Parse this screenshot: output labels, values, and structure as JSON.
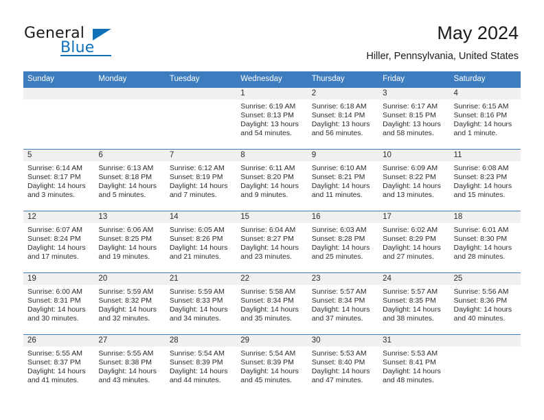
{
  "brand": {
    "word_one": "General",
    "word_two": "Blue",
    "accent_color": "#1071ba",
    "triangle_icon": "triangle-icon"
  },
  "header": {
    "month_title": "May 2024",
    "location": "Hiller, Pennsylvania, United States"
  },
  "calendar": {
    "header_bg": "#3d7cbf",
    "daynum_bg": "#f0f0f0",
    "weekday_headers": [
      "Sunday",
      "Monday",
      "Tuesday",
      "Wednesday",
      "Thursday",
      "Friday",
      "Saturday"
    ],
    "labels": {
      "sunrise": "Sunrise:",
      "sunset": "Sunset:",
      "daylight": "Daylight:"
    },
    "weeks": [
      [
        {
          "day": "",
          "sunrise": "",
          "sunset": "",
          "daylight_line1": "",
          "daylight_line2": ""
        },
        {
          "day": "",
          "sunrise": "",
          "sunset": "",
          "daylight_line1": "",
          "daylight_line2": ""
        },
        {
          "day": "",
          "sunrise": "",
          "sunset": "",
          "daylight_line1": "",
          "daylight_line2": ""
        },
        {
          "day": "1",
          "sunrise": "Sunrise: 6:19 AM",
          "sunset": "Sunset: 8:13 PM",
          "daylight_line1": "Daylight: 13 hours",
          "daylight_line2": "and 54 minutes."
        },
        {
          "day": "2",
          "sunrise": "Sunrise: 6:18 AM",
          "sunset": "Sunset: 8:14 PM",
          "daylight_line1": "Daylight: 13 hours",
          "daylight_line2": "and 56 minutes."
        },
        {
          "day": "3",
          "sunrise": "Sunrise: 6:17 AM",
          "sunset": "Sunset: 8:15 PM",
          "daylight_line1": "Daylight: 13 hours",
          "daylight_line2": "and 58 minutes."
        },
        {
          "day": "4",
          "sunrise": "Sunrise: 6:15 AM",
          "sunset": "Sunset: 8:16 PM",
          "daylight_line1": "Daylight: 14 hours",
          "daylight_line2": "and 1 minute."
        }
      ],
      [
        {
          "day": "5",
          "sunrise": "Sunrise: 6:14 AM",
          "sunset": "Sunset: 8:17 PM",
          "daylight_line1": "Daylight: 14 hours",
          "daylight_line2": "and 3 minutes."
        },
        {
          "day": "6",
          "sunrise": "Sunrise: 6:13 AM",
          "sunset": "Sunset: 8:18 PM",
          "daylight_line1": "Daylight: 14 hours",
          "daylight_line2": "and 5 minutes."
        },
        {
          "day": "7",
          "sunrise": "Sunrise: 6:12 AM",
          "sunset": "Sunset: 8:19 PM",
          "daylight_line1": "Daylight: 14 hours",
          "daylight_line2": "and 7 minutes."
        },
        {
          "day": "8",
          "sunrise": "Sunrise: 6:11 AM",
          "sunset": "Sunset: 8:20 PM",
          "daylight_line1": "Daylight: 14 hours",
          "daylight_line2": "and 9 minutes."
        },
        {
          "day": "9",
          "sunrise": "Sunrise: 6:10 AM",
          "sunset": "Sunset: 8:21 PM",
          "daylight_line1": "Daylight: 14 hours",
          "daylight_line2": "and 11 minutes."
        },
        {
          "day": "10",
          "sunrise": "Sunrise: 6:09 AM",
          "sunset": "Sunset: 8:22 PM",
          "daylight_line1": "Daylight: 14 hours",
          "daylight_line2": "and 13 minutes."
        },
        {
          "day": "11",
          "sunrise": "Sunrise: 6:08 AM",
          "sunset": "Sunset: 8:23 PM",
          "daylight_line1": "Daylight: 14 hours",
          "daylight_line2": "and 15 minutes."
        }
      ],
      [
        {
          "day": "12",
          "sunrise": "Sunrise: 6:07 AM",
          "sunset": "Sunset: 8:24 PM",
          "daylight_line1": "Daylight: 14 hours",
          "daylight_line2": "and 17 minutes."
        },
        {
          "day": "13",
          "sunrise": "Sunrise: 6:06 AM",
          "sunset": "Sunset: 8:25 PM",
          "daylight_line1": "Daylight: 14 hours",
          "daylight_line2": "and 19 minutes."
        },
        {
          "day": "14",
          "sunrise": "Sunrise: 6:05 AM",
          "sunset": "Sunset: 8:26 PM",
          "daylight_line1": "Daylight: 14 hours",
          "daylight_line2": "and 21 minutes."
        },
        {
          "day": "15",
          "sunrise": "Sunrise: 6:04 AM",
          "sunset": "Sunset: 8:27 PM",
          "daylight_line1": "Daylight: 14 hours",
          "daylight_line2": "and 23 minutes."
        },
        {
          "day": "16",
          "sunrise": "Sunrise: 6:03 AM",
          "sunset": "Sunset: 8:28 PM",
          "daylight_line1": "Daylight: 14 hours",
          "daylight_line2": "and 25 minutes."
        },
        {
          "day": "17",
          "sunrise": "Sunrise: 6:02 AM",
          "sunset": "Sunset: 8:29 PM",
          "daylight_line1": "Daylight: 14 hours",
          "daylight_line2": "and 27 minutes."
        },
        {
          "day": "18",
          "sunrise": "Sunrise: 6:01 AM",
          "sunset": "Sunset: 8:30 PM",
          "daylight_line1": "Daylight: 14 hours",
          "daylight_line2": "and 28 minutes."
        }
      ],
      [
        {
          "day": "19",
          "sunrise": "Sunrise: 6:00 AM",
          "sunset": "Sunset: 8:31 PM",
          "daylight_line1": "Daylight: 14 hours",
          "daylight_line2": "and 30 minutes."
        },
        {
          "day": "20",
          "sunrise": "Sunrise: 5:59 AM",
          "sunset": "Sunset: 8:32 PM",
          "daylight_line1": "Daylight: 14 hours",
          "daylight_line2": "and 32 minutes."
        },
        {
          "day": "21",
          "sunrise": "Sunrise: 5:59 AM",
          "sunset": "Sunset: 8:33 PM",
          "daylight_line1": "Daylight: 14 hours",
          "daylight_line2": "and 34 minutes."
        },
        {
          "day": "22",
          "sunrise": "Sunrise: 5:58 AM",
          "sunset": "Sunset: 8:34 PM",
          "daylight_line1": "Daylight: 14 hours",
          "daylight_line2": "and 35 minutes."
        },
        {
          "day": "23",
          "sunrise": "Sunrise: 5:57 AM",
          "sunset": "Sunset: 8:34 PM",
          "daylight_line1": "Daylight: 14 hours",
          "daylight_line2": "and 37 minutes."
        },
        {
          "day": "24",
          "sunrise": "Sunrise: 5:57 AM",
          "sunset": "Sunset: 8:35 PM",
          "daylight_line1": "Daylight: 14 hours",
          "daylight_line2": "and 38 minutes."
        },
        {
          "day": "25",
          "sunrise": "Sunrise: 5:56 AM",
          "sunset": "Sunset: 8:36 PM",
          "daylight_line1": "Daylight: 14 hours",
          "daylight_line2": "and 40 minutes."
        }
      ],
      [
        {
          "day": "26",
          "sunrise": "Sunrise: 5:55 AM",
          "sunset": "Sunset: 8:37 PM",
          "daylight_line1": "Daylight: 14 hours",
          "daylight_line2": "and 41 minutes."
        },
        {
          "day": "27",
          "sunrise": "Sunrise: 5:55 AM",
          "sunset": "Sunset: 8:38 PM",
          "daylight_line1": "Daylight: 14 hours",
          "daylight_line2": "and 43 minutes."
        },
        {
          "day": "28",
          "sunrise": "Sunrise: 5:54 AM",
          "sunset": "Sunset: 8:39 PM",
          "daylight_line1": "Daylight: 14 hours",
          "daylight_line2": "and 44 minutes."
        },
        {
          "day": "29",
          "sunrise": "Sunrise: 5:54 AM",
          "sunset": "Sunset: 8:39 PM",
          "daylight_line1": "Daylight: 14 hours",
          "daylight_line2": "and 45 minutes."
        },
        {
          "day": "30",
          "sunrise": "Sunrise: 5:53 AM",
          "sunset": "Sunset: 8:40 PM",
          "daylight_line1": "Daylight: 14 hours",
          "daylight_line2": "and 47 minutes."
        },
        {
          "day": "31",
          "sunrise": "Sunrise: 5:53 AM",
          "sunset": "Sunset: 8:41 PM",
          "daylight_line1": "Daylight: 14 hours",
          "daylight_line2": "and 48 minutes."
        },
        {
          "day": "",
          "sunrise": "",
          "sunset": "",
          "daylight_line1": "",
          "daylight_line2": ""
        }
      ]
    ]
  }
}
